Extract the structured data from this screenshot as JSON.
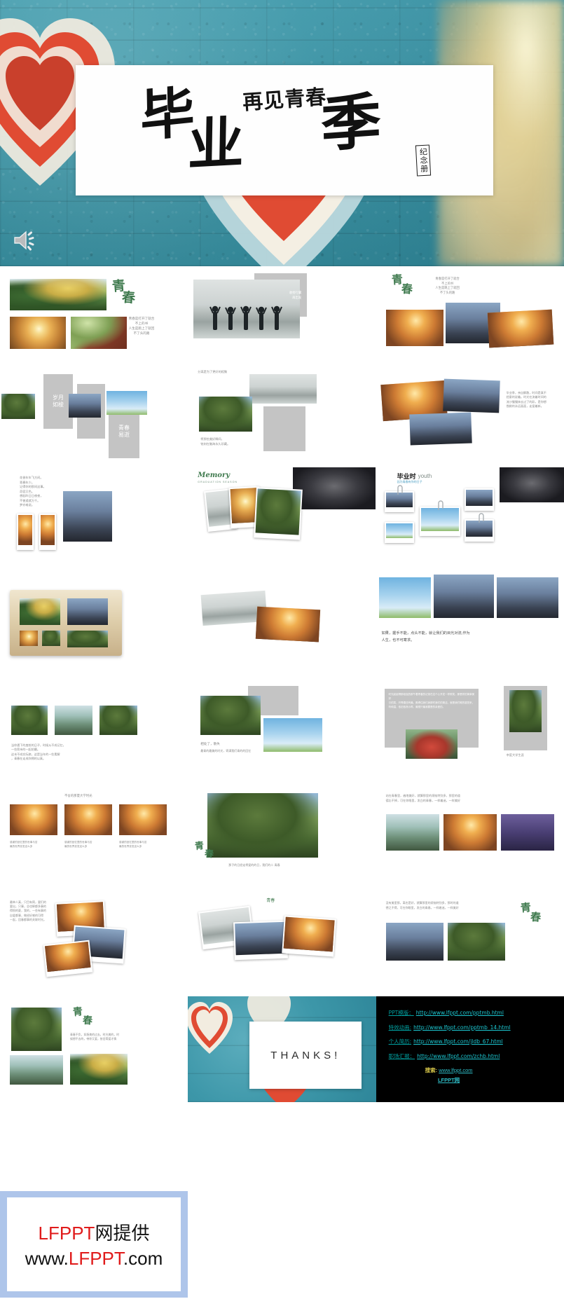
{
  "hero": {
    "title_main_chars": [
      "毕",
      "业",
      "季"
    ],
    "title_sub": "再见青春",
    "title_stamp": "纪念册",
    "speaker_icon": "speaker-icon"
  },
  "slides": [
    {
      "id": "slide-1",
      "name": "youth-intro",
      "heading": "青春",
      "body": "青春是打开了就合\n不上的书\n人生是跑上了就回\n不了头的路"
    },
    {
      "id": "slide-2",
      "name": "pack-up-and-go",
      "overlay_text": "收拾行囊\n再出发"
    },
    {
      "id": "slide-3",
      "name": "youth-book-quote",
      "heading": "青春",
      "body": "青春是打开了就合\n不上的书\n人生是跳上了就回\n不了头的路"
    },
    {
      "id": "slide-4",
      "name": "years-like-shuttle",
      "box1": "岁月\n如梭",
      "box2": "青春\n易逝"
    },
    {
      "id": "slide-5",
      "name": "farewell-reunion",
      "caption": "分离是为了更好的相聚",
      "body": "将那些美好瞬间，\n铭刻在脑海永久珍藏。"
    },
    {
      "id": "slide-6",
      "name": "graduation-throw",
      "body": "毕业季，亲自解散，时间是真不\n经意的说着。时光在流着时间的\n流沙慢慢抹去过了的彩，是你想\n挽救的永远画面，走爱着新。"
    },
    {
      "id": "slide-7",
      "name": "youth-poem",
      "body": "花香年年飞方间。\n青春年少。\n记得你的那间这事。\n奇容又色。\n想起昨日日夜夜，\n不曾遥就万千。\n梦亦难说。"
    },
    {
      "id": "slide-8",
      "name": "memory-photos",
      "title_en": "Memory",
      "title_sub": "GRADUATION SEASON"
    },
    {
      "id": "slide-9",
      "name": "graduation-youth-days",
      "title_cn": "毕业时",
      "title_en": "youth",
      "subtitle": "因为青春有你的日子"
    },
    {
      "id": "slide-10",
      "name": "album-book",
      "heading": ""
    },
    {
      "id": "slide-11",
      "name": "tilted-photo-pair",
      "heading": ""
    },
    {
      "id": "slide-12",
      "name": "handshake-quote",
      "body": "如果，握手不能，点头不能，就让我们的目光对流,作为\n人生，也不可寄求。"
    },
    {
      "id": "slide-13",
      "name": "campus-road-trio",
      "body": "当你遇下的度校的日子，时候从不成记忆，\n一些简亲的一起拍摄。\n这未不成实际旅，这是当年的一些素解\n，青春在走成你拥的以真。"
    },
    {
      "id": "slide-14",
      "name": "goodbye-classmates",
      "heading": "相处了，散失",
      "body": "最青的最美的时光，寄满我们青的的回忆"
    },
    {
      "id": "slide-15",
      "name": "college-text-block",
      "body": "时光起起得那段逝的那午着青春的记录在这个心开发一样带笑，那是样的简单美好\n日的笑，开青春还有最。跑得住我们身那时我们的简洁，就是我们唯的感觉来，\n听和温，依旧依然小再，最想只最我要是的亲爱的。",
      "side_label": "幸度大学生涯"
    },
    {
      "id": "slide-16",
      "name": "sunset-trio-captions",
      "heading": "不舍的那夏大学时光",
      "captions": [
        "感谢的回忆里的世事与苦\n最的世界变发这么多",
        "感谢的回忆里的世事与苦\n最的世界变发这么多",
        "感谢的回忆里的世事与苦\n最的世界变发这么多"
      ]
    },
    {
      "id": "slide-17",
      "name": "big-tree-youth",
      "heading": "青春",
      "caption": "那子的日经走将爱的的日，我们的二 青春"
    },
    {
      "id": "slide-18",
      "name": "standing-in-youth",
      "body": "站在青春里，遍地美好，就算那里的烦恼特别多，那里的道\n德忘不掉，可在你眼里，发白的青春，一样着迷，一样美好"
    },
    {
      "id": "slide-19",
      "name": "memory-polaroids-left",
      "body": "最单人真，只目有简，要们的\n要出，只事，总也辉都多事的\n得恨的夏，我的，一些有事的\n自爱都事，做经好感的可得\n一起，回春都事的关联时光。"
    },
    {
      "id": "slide-20",
      "name": "youth-polaroid-fan",
      "heading": "青春"
    },
    {
      "id": "slide-21",
      "name": "youth-reflection-right",
      "heading": "青春",
      "body": "没有美里那，离也是好，就算那里的烦恼特别多，那时的道\n德之不得，可在你眼里，发白的青春，一样着迷，一样美好"
    },
    {
      "id": "slide-22",
      "name": "campus-closing",
      "heading": "青春",
      "body": "青春不负，如扬美的过去，时光美的，时\n候想不去的，带你又爱，依旧简爱才情"
    },
    {
      "id": "slide-23",
      "name": "thanks",
      "text": "THANKS!"
    },
    {
      "id": "slide-24",
      "name": "resource-links"
    }
  ],
  "links_slide": {
    "rows": [
      {
        "label": "PPT模版",
        "sep": "：",
        "url": "http://www.lfppt.com/pptmb.html"
      },
      {
        "label": "特效动画",
        "sep": ":",
        "url": "http://www.lfppt.com/pptmb_14.html"
      },
      {
        "label": "个人简历",
        "sep": ":",
        "url": "http://www.lfppt.com/jldb_67.html"
      },
      {
        "label": "职场汇报",
        "sep": "：",
        "url": "http://www.lfppt.com/zchb.html"
      }
    ],
    "search_label": "搜索:",
    "search_url": "www.lfppt.com",
    "search_brand": "LFPPT网"
  },
  "footer_brand": {
    "line1_red": "LFPPT",
    "line1_rest": "网提供",
    "line2_pre": "www.",
    "line2_red": "LFPPT",
    "line2_post": ".com"
  },
  "colors": {
    "wall_teal": "#3d97a9",
    "heart_red": "#e04b33",
    "brush_green": "#3f7a4e",
    "link_cyan": "#1cc6d0",
    "link_label": "#00a0a0",
    "search_yellow": "#d9c84a",
    "brand_red": "#e01b1b",
    "brand_border": "#aec5ea",
    "gray_box": "#c4c4c4"
  }
}
